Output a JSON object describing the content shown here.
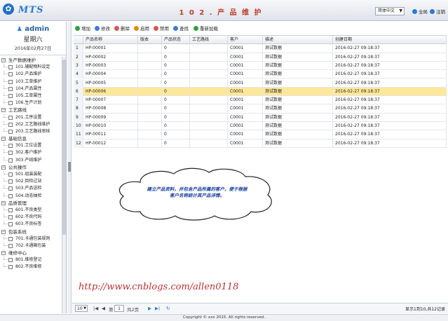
{
  "header": {
    "logo_text": "MTS",
    "title": "1 0 2 . 产 品 维 护",
    "language": "简体中文",
    "links": [
      {
        "label": "全局",
        "color": "#2b7bd0"
      },
      {
        "label": "注销",
        "color": "#2b7bd0"
      }
    ]
  },
  "user": {
    "name": "admin",
    "weekday": "星期六",
    "date": "2016年02月27日"
  },
  "tree": [
    {
      "label": "生产数据维护",
      "items": [
        "101.辅配物料设定",
        "102.产品维护",
        "103.工单维护",
        "104.产品属性",
        "105.工单属性",
        "106.生产计划"
      ]
    },
    {
      "label": "工艺路线",
      "items": [
        "201.工序设置",
        "202.工艺路线维护",
        "203.工艺路线审核"
      ]
    },
    {
      "label": "基础信息",
      "items": [
        "301.工位设置",
        "302.客户维护",
        "303.产线维护"
      ]
    },
    {
      "label": "公共操作",
      "items": [
        "501.组装装配",
        "502.目检过站",
        "503.产品送检",
        "504.动态抽验"
      ]
    },
    {
      "label": "品质管理",
      "items": [
        "601.不良类型",
        "602.不良代码",
        "603.不良标签"
      ]
    },
    {
      "label": "包装系统",
      "items": [
        "701.卡通包装规则",
        "702.卡通箱包装"
      ]
    },
    {
      "label": "维修中心",
      "items": [
        "801.维修登记",
        "802.不良维修"
      ]
    }
  ],
  "toolbar": [
    {
      "label": "增加",
      "icon": "add-icon",
      "color": "#2e9e3e"
    },
    {
      "label": "修改",
      "icon": "edit-icon",
      "color": "#3a7bd5"
    },
    {
      "label": "删除",
      "icon": "delete-icon",
      "color": "#d9534f"
    },
    {
      "label": "启用",
      "icon": "enable-icon",
      "color": "#e68a00"
    },
    {
      "label": "禁用",
      "icon": "disable-icon",
      "color": "#d9534f"
    },
    {
      "label": "查找",
      "icon": "search-icon",
      "color": "#3a7bd5"
    },
    {
      "label": "重新加载",
      "icon": "reload-icon",
      "color": "#2e9e3e"
    }
  ],
  "table": {
    "columns": [
      "产品名称",
      "版本",
      "产品状态",
      "工艺路线",
      "客户",
      "描述",
      "创建日期"
    ],
    "selected_row": 6,
    "rows": [
      [
        "1",
        "HP-00001",
        "",
        "0",
        "",
        "C0001",
        "测试数据",
        "2016-02-27 09:18:37"
      ],
      [
        "2",
        "HP-00002",
        "",
        "0",
        "",
        "C0001",
        "测试数据",
        "2016-02-27 09:18:37"
      ],
      [
        "3",
        "HP-00003",
        "",
        "0",
        "",
        "C0001",
        "测试数据",
        "2016-02-27 09:18:37"
      ],
      [
        "4",
        "HP-00004",
        "",
        "0",
        "",
        "C0001",
        "测试数据",
        "2016-02-27 09:18:37"
      ],
      [
        "5",
        "HP-00005",
        "",
        "0",
        "",
        "C0001",
        "测试数据",
        "2016-02-27 09:18:37"
      ],
      [
        "6",
        "HP-00006",
        "",
        "0",
        "",
        "C0001",
        "测试数据",
        "2016-02-27 09:18:37"
      ],
      [
        "7",
        "HP-00007",
        "",
        "0",
        "",
        "C0001",
        "测试数据",
        "2016-02-27 09:18:37"
      ],
      [
        "8",
        "HP-00008",
        "",
        "0",
        "",
        "C0001",
        "测试数据",
        "2016-02-27 09:18:37"
      ],
      [
        "9",
        "HP-00009",
        "",
        "0",
        "",
        "C0001",
        "测试数据",
        "2016-02-27 09:18:37"
      ],
      [
        "10",
        "HP-00010",
        "",
        "0",
        "",
        "C0001",
        "测试数据",
        "2016-02-27 09:18:37"
      ],
      [
        "11",
        "HP-00011",
        "",
        "0",
        "",
        "C0001",
        "测试数据",
        "2016-02-27 09:18:37"
      ],
      [
        "12",
        "HP-00012",
        "",
        "0",
        "",
        "C0001",
        "测试数据",
        "2016-02-27 09:18:37"
      ]
    ]
  },
  "callout": {
    "line1": "建立产品资料，并包含产品所属的客户，便于根据",
    "line2": "客户名称统计其产品详情。"
  },
  "watermark_url": "http://www.cnblogs.com/allen0118",
  "pager": {
    "page_size": "10",
    "page_label": "第",
    "page": "1",
    "total_pages": "共2页",
    "info": "显示1到10,共12记录"
  },
  "footer": "Copyright © xxx 2015. All rights reserved."
}
